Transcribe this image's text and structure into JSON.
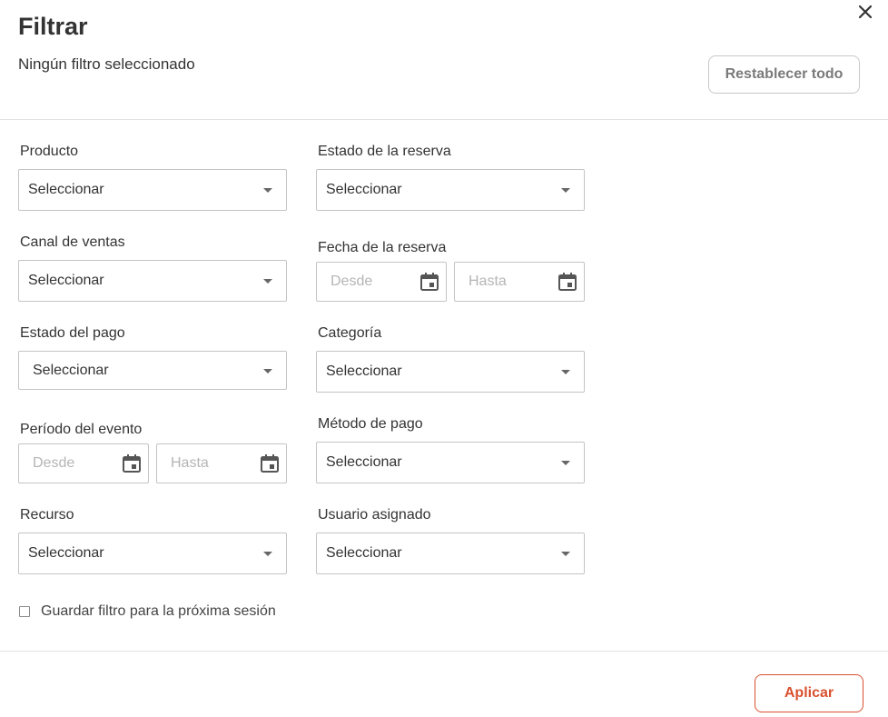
{
  "header": {
    "title": "Filtrar",
    "subtitle": "Ningún filtro seleccionado",
    "reset_label": "Restablecer todo"
  },
  "filters": {
    "producto": {
      "label": "Producto",
      "value": "Seleccionar"
    },
    "estado_reserva": {
      "label": "Estado de la reserva",
      "value": "Seleccionar"
    },
    "canal_ventas": {
      "label": "Canal de ventas",
      "value": "Seleccionar"
    },
    "fecha_reserva": {
      "label": "Fecha de la reserva",
      "from_placeholder": "Desde",
      "to_placeholder": "Hasta"
    },
    "estado_pago": {
      "label": "Estado del pago",
      "value": "Seleccionar"
    },
    "categoria": {
      "label": "Categoría",
      "value": "Seleccionar"
    },
    "periodo_evento": {
      "label": "Período del evento",
      "from_placeholder": "Desde",
      "to_placeholder": "Hasta"
    },
    "metodo_pago": {
      "label": "Método de pago",
      "value": "Seleccionar"
    },
    "recurso": {
      "label": "Recurso",
      "value": "Seleccionar"
    },
    "usuario_asignado": {
      "label": "Usuario asignado",
      "value": "Seleccionar"
    }
  },
  "save_filter": {
    "label": "Guardar filtro para la próxima sesión",
    "checked": false
  },
  "footer": {
    "apply_label": "Aplicar"
  },
  "colors": {
    "accent": "#d9502e",
    "border": "#c4c4c4",
    "text": "#333333",
    "placeholder": "#b5b5b5"
  },
  "icons": {
    "close": "close-icon",
    "calendar": "calendar-icon",
    "caret": "chevron-down-icon"
  }
}
